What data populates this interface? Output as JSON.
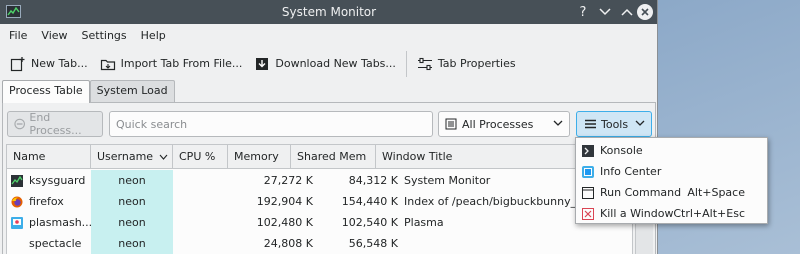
{
  "window": {
    "title": "System Monitor",
    "help_label": "?"
  },
  "menubar": [
    "File",
    "View",
    "Settings",
    "Help"
  ],
  "toolbar": {
    "new_tab": "New Tab...",
    "import_tab": "Import Tab From File...",
    "download_tabs": "Download New Tabs...",
    "tab_properties": "Tab Properties"
  },
  "tabs": [
    "Process Table",
    "System Load"
  ],
  "controls": {
    "end_process": "End Process...",
    "search_placeholder": "Quick search",
    "filter_value": "All Processes",
    "tools_label": "Tools"
  },
  "table": {
    "columns": [
      "Name",
      "Username",
      "CPU %",
      "Memory",
      "Shared Mem",
      "Window Title"
    ],
    "rows": [
      {
        "icon": "ksysguard-icon",
        "name": "ksysguard",
        "user": "neon",
        "cpu": "",
        "memory": "27,272 K",
        "shared": "84,312 K",
        "title": "System Monitor"
      },
      {
        "icon": "firefox-icon",
        "name": "firefox",
        "user": "neon",
        "cpu": "",
        "memory": "192,904 K",
        "shared": "154,440 K",
        "title": "Index of /peach/bigbuckbunny_movies/"
      },
      {
        "icon": "plasmashell-icon",
        "name": "plasmash...",
        "user": "neon",
        "cpu": "",
        "memory": "102,480 K",
        "shared": "102,540 K",
        "title": "Plasma"
      },
      {
        "icon": "",
        "name": "spectacle",
        "user": "neon",
        "cpu": "",
        "memory": "24,808 K",
        "shared": "56,548 K",
        "title": ""
      }
    ]
  },
  "tools_menu": [
    {
      "icon": "konsole-icon",
      "label": "Konsole",
      "shortcut": ""
    },
    {
      "icon": "info-icon",
      "label": "Info Center",
      "shortcut": ""
    },
    {
      "icon": "run-icon",
      "label": "Run Command",
      "shortcut": "Alt+Space"
    },
    {
      "icon": "kill-icon",
      "label": "Kill a Window",
      "shortcut": "Ctrl+Alt+Esc"
    }
  ],
  "colors": {
    "titlebar": "#475057",
    "accent": "#3daee9",
    "username_bg": "#c8f0f0",
    "window_bg": "#eff0f1"
  }
}
